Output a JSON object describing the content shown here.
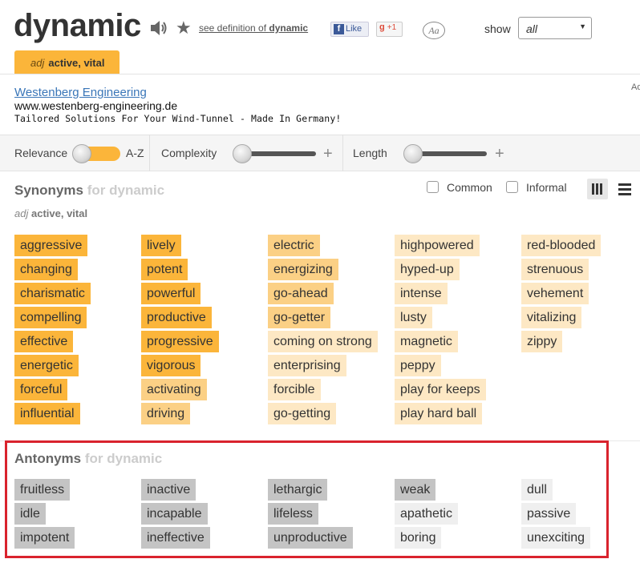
{
  "header": {
    "word": "dynamic",
    "see_definition_prefix": "see definition of ",
    "see_definition_word": "dynamic",
    "fb_like": "Like",
    "gplus": "+1",
    "font_toggle": "Aa",
    "show_label": "show",
    "show_value": "all",
    "sense_tab": {
      "pos": "adj",
      "definition": "active, vital"
    }
  },
  "ad": {
    "title": "Westenberg Engineering",
    "url": "www.westenberg-engineering.de",
    "description": "Tailored Solutions For Your Wind-Tunnel - Made In Germany!",
    "corner": "Ad"
  },
  "filters": {
    "relevance": "Relevance",
    "az": "A-Z",
    "sort_mode": "relevance",
    "complexity": "Complexity",
    "complexity_level": 0,
    "length": "Length",
    "length_level": 0,
    "plus": "+"
  },
  "synonyms": {
    "heading": "Synonyms",
    "heading_for": "for dynamic",
    "sense_pos": "adj",
    "sense_def": "active, vital",
    "common": "Common",
    "informal": "Informal",
    "columns": [
      [
        [
          "aggressive",
          3
        ],
        [
          "changing",
          3
        ],
        [
          "charismatic",
          3
        ],
        [
          "compelling",
          3
        ],
        [
          "effective",
          3
        ],
        [
          "energetic",
          3
        ],
        [
          "forceful",
          3
        ],
        [
          "influential",
          3
        ]
      ],
      [
        [
          "lively",
          3
        ],
        [
          "potent",
          3
        ],
        [
          "powerful",
          3
        ],
        [
          "productive",
          3
        ],
        [
          "progressive",
          3
        ],
        [
          "vigorous",
          3
        ],
        [
          "activating",
          2
        ],
        [
          "driving",
          2
        ]
      ],
      [
        [
          "electric",
          2
        ],
        [
          "energizing",
          2
        ],
        [
          "go-ahead",
          2
        ],
        [
          "go-getter",
          2
        ],
        [
          "coming on strong",
          1
        ],
        [
          "enterprising",
          1
        ],
        [
          "forcible",
          1
        ],
        [
          "go-getting",
          1
        ]
      ],
      [
        [
          "highpowered",
          1
        ],
        [
          "hyped-up",
          1
        ],
        [
          "intense",
          1
        ],
        [
          "lusty",
          1
        ],
        [
          "magnetic",
          1
        ],
        [
          "peppy",
          1
        ],
        [
          "play for keeps",
          1
        ],
        [
          "play hard ball",
          1
        ]
      ],
      [
        [
          "red-blooded",
          1
        ],
        [
          "strenuous",
          1
        ],
        [
          "vehement",
          1
        ],
        [
          "vitalizing",
          1
        ],
        [
          "zippy",
          1
        ]
      ]
    ]
  },
  "antonyms": {
    "heading": "Antonyms",
    "heading_for": "for dynamic",
    "columns": [
      [
        [
          "fruitless",
          3
        ],
        [
          "idle",
          3
        ],
        [
          "impotent",
          3
        ]
      ],
      [
        [
          "inactive",
          3
        ],
        [
          "incapable",
          3
        ],
        [
          "ineffective",
          3
        ]
      ],
      [
        [
          "lethargic",
          3
        ],
        [
          "lifeless",
          3
        ],
        [
          "unproductive",
          3
        ]
      ],
      [
        [
          "weak",
          3
        ],
        [
          "apathetic",
          1
        ],
        [
          "boring",
          1
        ]
      ],
      [
        [
          "dull",
          1
        ],
        [
          "passive",
          1
        ],
        [
          "unexciting",
          1
        ]
      ]
    ]
  },
  "colors": {
    "relevance_high": "#fbb53a",
    "relevance_mid": "#fbd085",
    "relevance_low": "#fde8c4",
    "antonym_high": "#c4c4c4",
    "antonym_low": "#efefef",
    "highlight_box": "#d9232d"
  }
}
